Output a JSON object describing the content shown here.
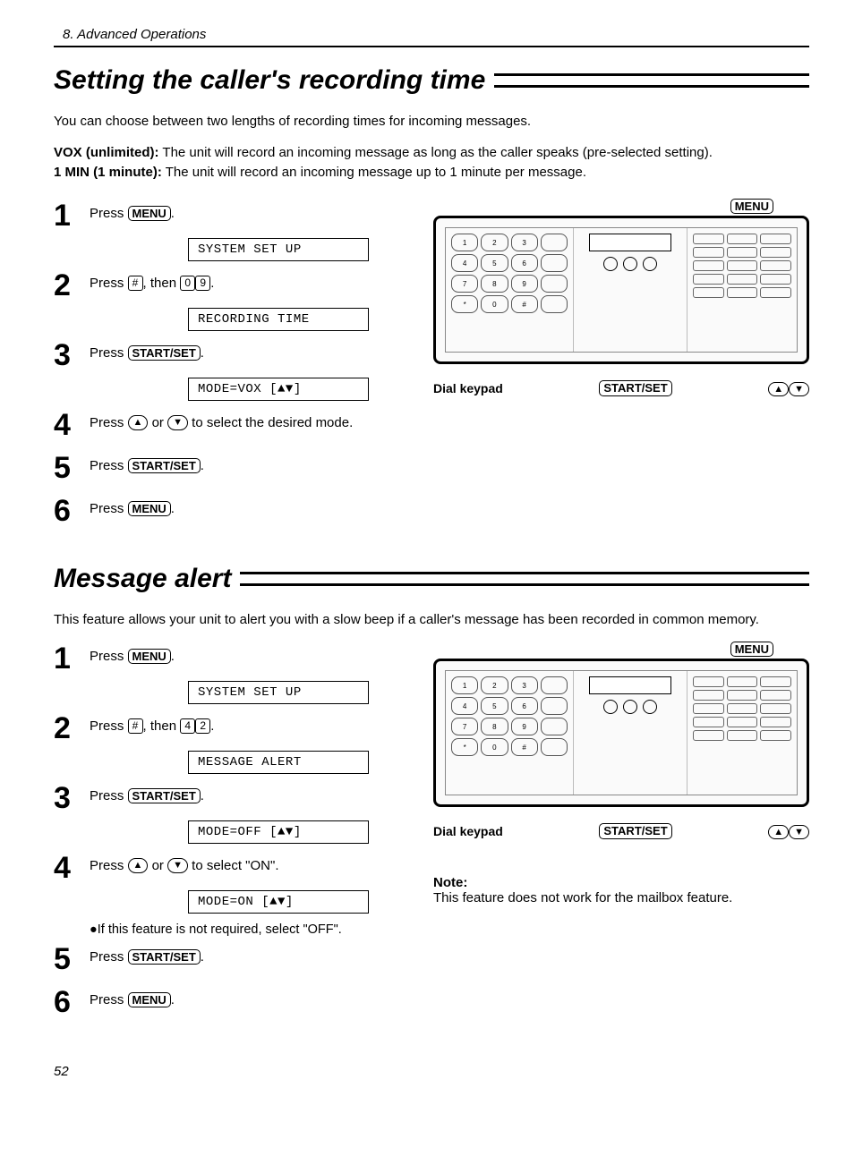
{
  "chapter": "8.  Advanced Operations",
  "page_number": "52",
  "section1": {
    "title": "Setting the caller's recording time",
    "intro": "You can choose between two lengths of recording times for incoming messages.",
    "def_vox_term": "VOX (unlimited):",
    "def_vox_text": "The unit will record an incoming message as long as the caller speaks (pre-selected setting).",
    "def_1min_term": "1 MIN (1 minute):",
    "def_1min_text": "The unit will record an incoming message up to 1 minute per message.",
    "steps": {
      "s1_pre": "Press ",
      "s1_btn": "MENU",
      "disp1": "SYSTEM SET UP",
      "s2_pre": "Press ",
      "s2_hash": "#",
      "s2_mid": ", then ",
      "s2_k1": "0",
      "s2_k2": "9",
      "disp2": "RECORDING TIME",
      "s3_pre": "Press ",
      "s3_btn": "START/SET",
      "disp3": "MODE=VOX    [▲▼]",
      "s4_pre": "Press ",
      "s4_up": "▲",
      "s4_or": " or ",
      "s4_down": "▼",
      "s4_post": " to select the desired mode.",
      "s5_pre": "Press ",
      "s5_btn": "START/SET",
      "s6_pre": "Press ",
      "s6_btn": "MENU"
    },
    "diagram": {
      "menu": "MENU",
      "dial_keypad": "Dial keypad",
      "start_set": "START/SET",
      "up": "▲",
      "down": "▼"
    }
  },
  "section2": {
    "title": "Message alert",
    "intro": "This feature allows your unit to alert you with a slow beep if a caller's message has been recorded in common memory.",
    "steps": {
      "s1_pre": "Press ",
      "s1_btn": "MENU",
      "disp1": "SYSTEM SET UP",
      "s2_pre": "Press ",
      "s2_hash": "#",
      "s2_mid": ", then ",
      "s2_k1": "4",
      "s2_k2": "2",
      "disp2": "MESSAGE ALERT",
      "s3_pre": "Press ",
      "s3_btn": "START/SET",
      "disp3": "MODE=OFF    [▲▼]",
      "s4_pre": "Press ",
      "s4_up": "▲",
      "s4_or": " or ",
      "s4_down": "▼",
      "s4_post": " to select \"ON\".",
      "disp4": "MODE=ON     [▲▼]",
      "bullet": "●If this feature is not required, select \"OFF\".",
      "s5_pre": "Press ",
      "s5_btn": "START/SET",
      "s6_pre": "Press ",
      "s6_btn": "MENU"
    },
    "diagram": {
      "menu": "MENU",
      "dial_keypad": "Dial keypad",
      "start_set": "START/SET",
      "up": "▲",
      "down": "▼"
    },
    "note_head": "Note:",
    "note_text": "This feature does not work for the mailbox feature."
  }
}
